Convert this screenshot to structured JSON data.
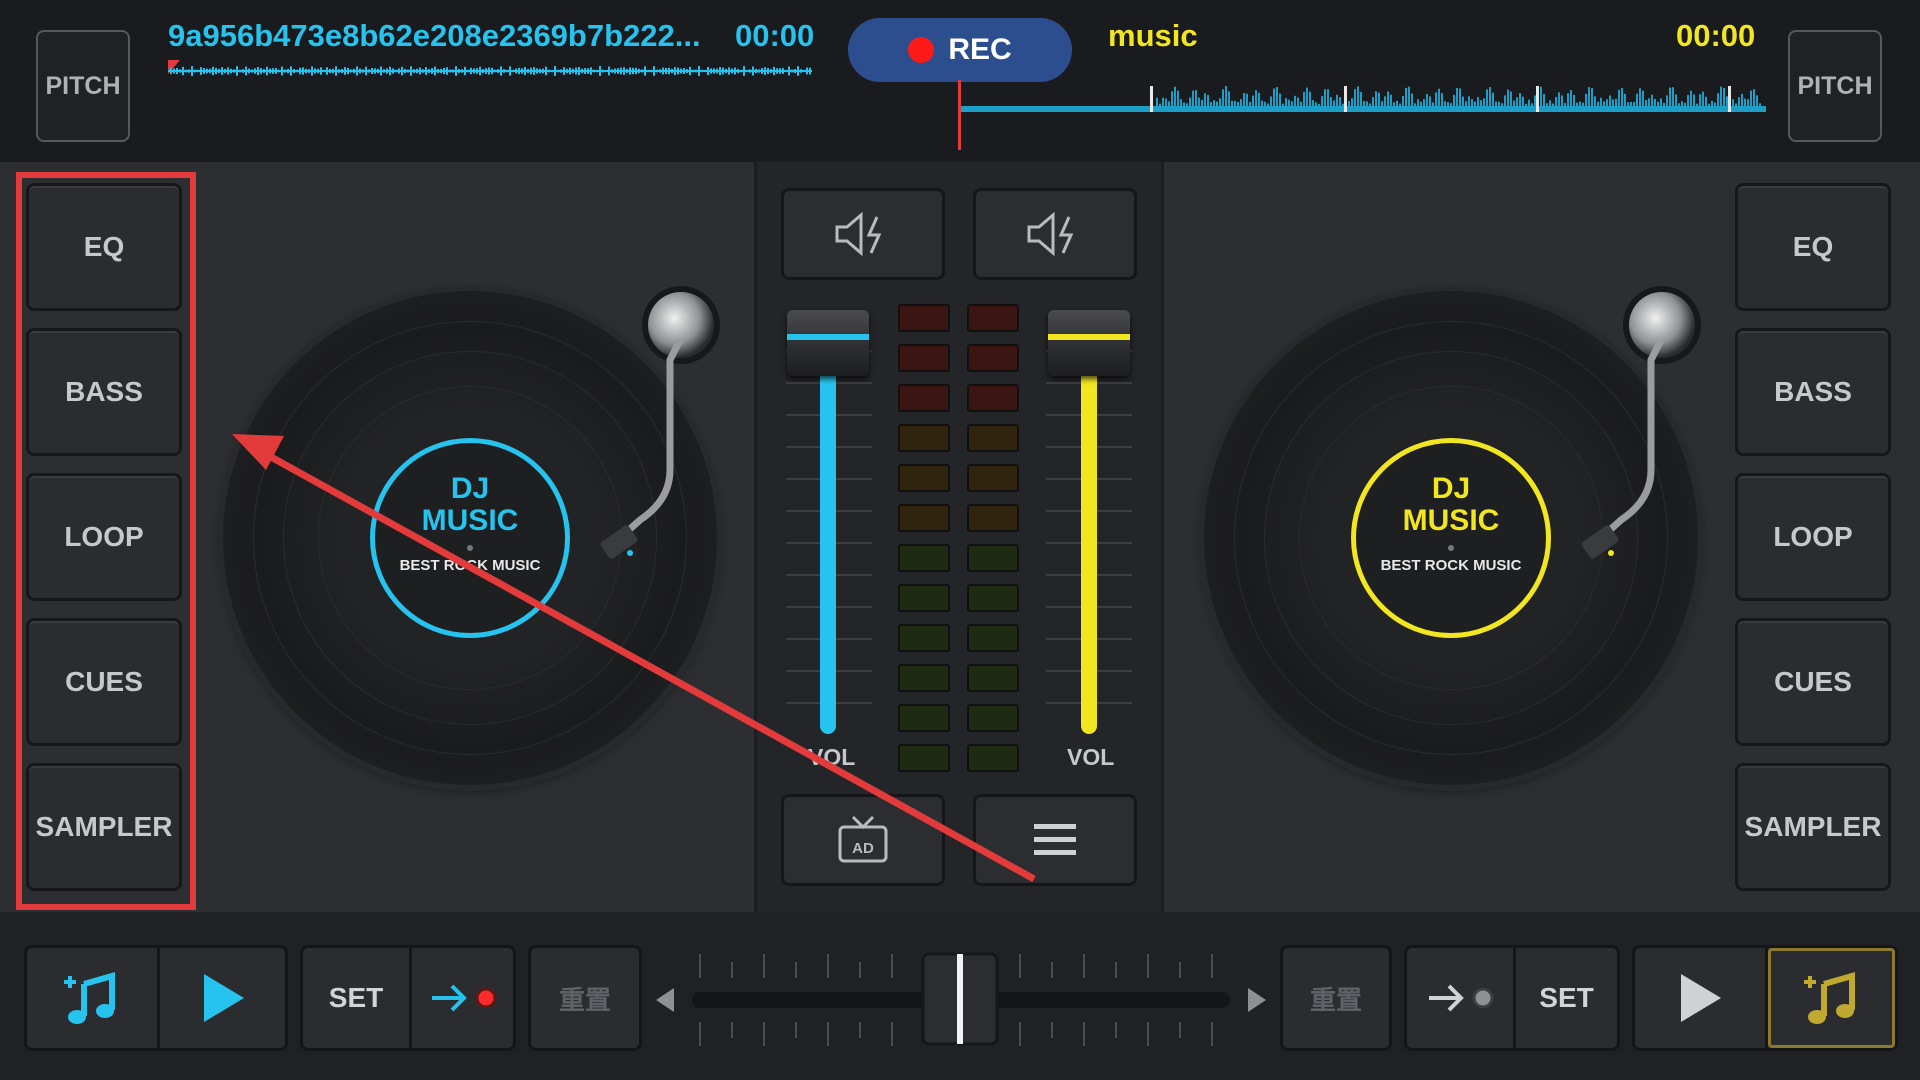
{
  "top": {
    "pitch_left": "PITCH",
    "pitch_right": "PITCH",
    "deck_a_title": "9a956b473e8b62e208e2369b7b222...",
    "deck_a_time": "00:00",
    "rec_label": "REC",
    "deck_b_title": "music",
    "deck_b_time": "00:00"
  },
  "left_panel": {
    "items": [
      "EQ",
      "BASS",
      "LOOP",
      "CUES",
      "SAMPLER"
    ]
  },
  "right_panel": {
    "items": [
      "EQ",
      "BASS",
      "LOOP",
      "CUES",
      "SAMPLER"
    ]
  },
  "deck_a": {
    "label_line1": "DJ",
    "label_line2": "MUSIC",
    "label_sub": "BEST ROCK MUSIC",
    "accent": "#27c3ef"
  },
  "deck_b": {
    "label_line1": "DJ",
    "label_line2": "MUSIC",
    "label_sub": "BEST ROCK MUSIC",
    "accent": "#f2e621"
  },
  "mixer": {
    "vol_left": "VOL",
    "vol_right": "VOL",
    "vol_left_level": 1.0,
    "vol_right_level": 1.0,
    "ad_label": "AD"
  },
  "bottom": {
    "set_left": "SET",
    "reset_left": "重置",
    "reset_right": "重置",
    "set_right": "SET",
    "crossfader_position": 0.5
  },
  "colors": {
    "blue_accent": "#27c3ef",
    "yellow_accent": "#f2e621",
    "rec_red": "#ff1a1a",
    "annotation_red": "#e33b3b"
  },
  "icons": [
    "speaker-mute-icon",
    "ad-tv-icon",
    "hamburger-menu-icon",
    "add-music-icon",
    "play-icon",
    "arrow-right-icon",
    "arrow-left-icon"
  ]
}
